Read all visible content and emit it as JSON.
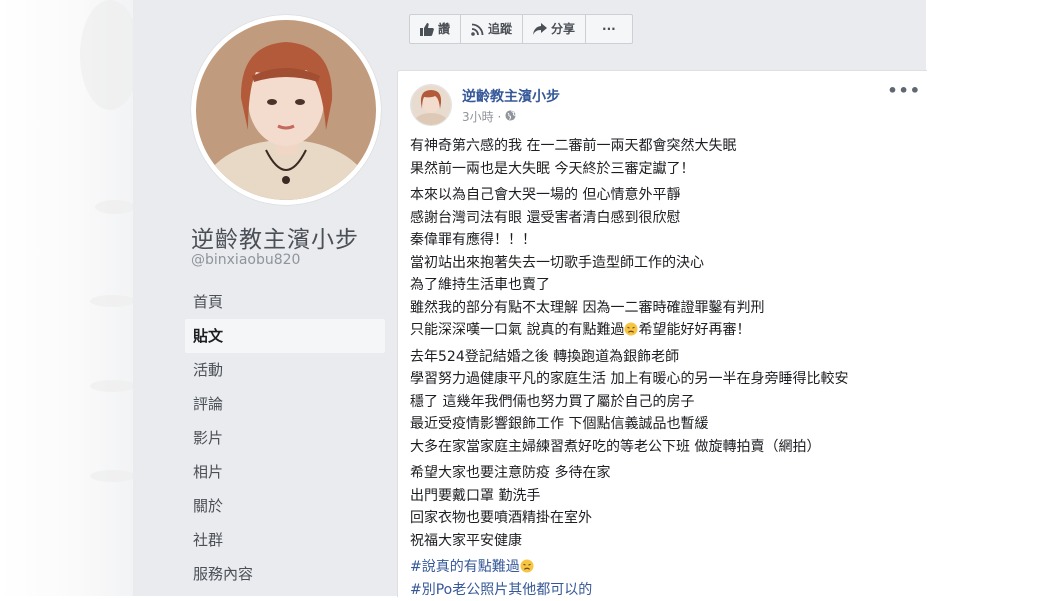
{
  "page": {
    "name": "逆齡教主濱小步",
    "handle": "@binxiaobu820"
  },
  "nav": [
    {
      "label": "首頁"
    },
    {
      "label": "貼文"
    },
    {
      "label": "活動"
    },
    {
      "label": "評論"
    },
    {
      "label": "影片"
    },
    {
      "label": "相片"
    },
    {
      "label": "關於"
    },
    {
      "label": "社群"
    },
    {
      "label": "服務內容"
    }
  ],
  "actions": {
    "like": "讚",
    "follow": "追蹤",
    "share": "分享",
    "more": "···"
  },
  "post": {
    "author": "逆齡教主濱小步",
    "time": "3小時 ·",
    "more": "•••",
    "p1": [
      "有神奇第六感的我 在一二審前一兩天都會突然大失眠",
      "果然前一兩也是大失眠 今天終於三審定讞了！"
    ],
    "p2": [
      "本來以為自己會大哭一場的 但心情意外平靜",
      "感謝台灣司法有眼 還受害者清白感到很欣慰",
      "秦偉罪有應得！！！",
      "當初站出來抱著失去一切歌手造型師工作的決心",
      "為了維持生活車也賣了",
      "雖然我的部分有點不太理解 因為一二審時確證罪鑿有判刑"
    ],
    "p2_last": "只能深深嘆一口氣 說真的有點難過",
    "p2_last_tail": "希望能好好再審！",
    "p3": [
      "去年524登記結婚之後 轉換跑道為銀飾老師",
      "學習努力過健康平凡的家庭生活 加上有暖心的另一半在身旁睡得比較安",
      "穩了 這幾年我們倆也努力買了屬於自己的房子",
      "最近受疫情影響銀飾工作 下個點信義誠品也暫緩",
      "大多在家當家庭主婦練習煮好吃的等老公下班 做旋轉拍賣（網拍）"
    ],
    "p4": [
      "希望大家也要注意防疫 多待在家",
      "出門要戴口罩 勤洗手",
      "回家衣物也要噴酒精掛在室外",
      "祝福大家平安健康"
    ],
    "hashtag1": "#說真的有點難過",
    "hashtag2": "#別Po老公照片其他都可以的"
  },
  "colors": {
    "link": "#365899",
    "background": "#e9ebee",
    "emoji": "#f7c542"
  },
  "icons": [
    "like-icon",
    "follow-icon",
    "share-icon",
    "globe-icon",
    "sad-emoji-icon"
  ]
}
